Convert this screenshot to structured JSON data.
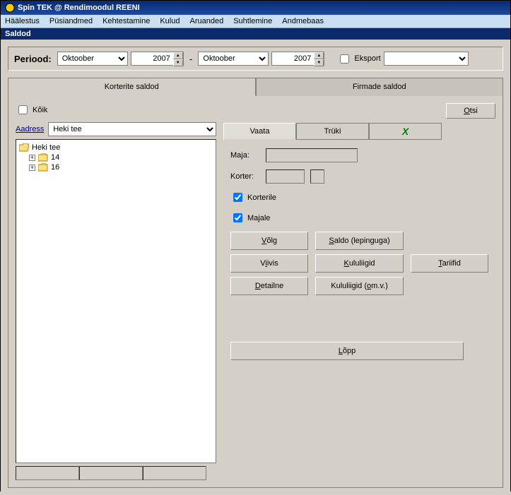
{
  "window": {
    "title": "Spin TEK @ Rendimoodul REENI"
  },
  "menu": {
    "items": [
      "Häälestus",
      "Püsiandmed",
      "Kehtestamine",
      "Kulud",
      "Aruanded",
      "Suhtlemine",
      "Andmebaas"
    ]
  },
  "subtitle": "Saldod",
  "period": {
    "label": "Periood:",
    "from_month": "Oktoober",
    "from_year": "2007",
    "to_month": "Oktoober",
    "to_year": "2007",
    "export_label": "Eksport"
  },
  "tabs": {
    "korterite": "Korterite saldod",
    "firmade": "Firmade saldod"
  },
  "left": {
    "koik_label": "Kõik",
    "aadress_label": "Aadress",
    "aadress_value": "Heki tee",
    "tree": {
      "root": "Heki tee",
      "children": [
        "14",
        "16"
      ]
    }
  },
  "right": {
    "otsi": "Otsi",
    "subtabs": {
      "vaata": "Vaata",
      "truki": "Trüki"
    },
    "maja_label": "Maja:",
    "korter_label": "Korter:",
    "korterile_label": "Korterile",
    "majale_label": "Majale",
    "buttons": {
      "volg": "Võlg",
      "saldo": "Saldo (lepinguga)",
      "viivis": "Viivis",
      "kululiigid": "Kululiigid",
      "tariifid": "Tariifid",
      "detailne": "Detailne",
      "kululiigid_omv": "Kululiigid (om.v.)",
      "lopp": "Lõpp"
    }
  }
}
